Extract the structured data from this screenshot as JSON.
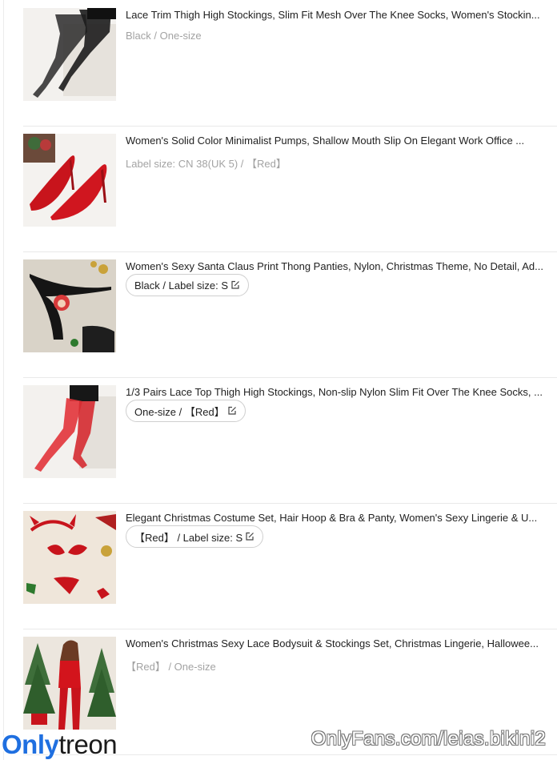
{
  "items": [
    {
      "title": "Lace Trim Thigh High Stockings, Slim Fit Mesh Over The Knee Socks, Women's Stockin...",
      "variant": "Black / One-size",
      "variant_style": "plain"
    },
    {
      "title": "Women's Solid Color Minimalist Pumps, Shallow Mouth Slip On Elegant Work Office ...",
      "variant": "Label size: CN 38(UK 5) / 【Red】",
      "variant_style": "plain"
    },
    {
      "title": "Women's Sexy Santa Claus Print Thong Panties, Nylon, Christmas Theme, No Detail, Ad...",
      "variant": "Black / Label size: S",
      "variant_style": "pill"
    },
    {
      "title": "1/3 Pairs Lace Top Thigh High Stockings, Non-slip Nylon Slim Fit Over The Knee Socks, ...",
      "variant": "One-size / 【Red】",
      "variant_style": "pill"
    },
    {
      "title": "Elegant Christmas Costume Set, Hair Hoop & Bra & Panty, Women's Sexy Lingerie & U...",
      "variant": "【Red】 / Label size: S",
      "variant_style": "pill"
    },
    {
      "title": "Women's Christmas Sexy Lace Bodysuit & Stockings Set, Christmas Lingerie, Hallowee...",
      "variant": "【Red】 / One-size",
      "variant_style": "plain"
    }
  ],
  "watermark": {
    "left_part1": "Only",
    "left_part2": "treon",
    "right": "OnlyFans.com/leias.bikini2"
  }
}
